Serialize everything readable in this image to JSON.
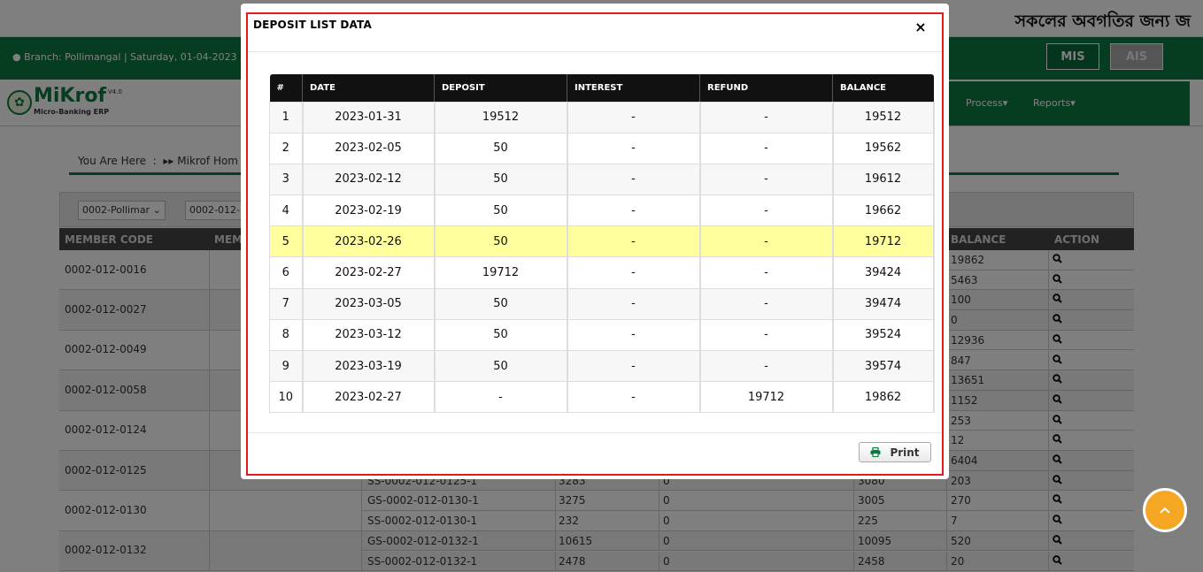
{
  "page": {
    "slogan": "সকলের অবগতির জন্য জ",
    "branch_info": "Branch: Pollimangal | Saturday, 01-04-2023",
    "mis_label": "MIS",
    "ais_label": "AIS",
    "logo": {
      "name": "MiKrof",
      "version": "V4.0",
      "subtitle": "Micro-Banking ERP"
    },
    "nav": {
      "process": "Process",
      "reports": "Reports"
    },
    "breadcrumb": {
      "prefix": "You Are Here",
      "item": "Mikrof Hom"
    },
    "filters": {
      "branch": "0002-Pollimar",
      "member": "0002-012-"
    },
    "table_headers": {
      "member_code": "MEMBER CODE",
      "member": "MEMB",
      "balance": "BALANCE",
      "action": "ACTION"
    },
    "members": [
      "0002-012-0016",
      "0002-012-0027",
      "0002-012-0049",
      "0002-012-0058",
      "0002-012-0124",
      "0002-012-0125",
      "0002-012-0130",
      "0002-012-0132"
    ],
    "balances": [
      "19862",
      "5463",
      "100",
      "0",
      "12936",
      "847",
      "13651",
      "1152",
      "253",
      "12",
      "6404",
      "203",
      "270",
      "7",
      "520",
      "20"
    ],
    "partial_rows": [
      {
        "account": "SS-0002-012-0125-1",
        "a": "3283",
        "b": "0",
        "c": "3080"
      },
      {
        "account": "GS-0002-012-0130-1",
        "a": "3275",
        "b": "0",
        "c": "3005"
      },
      {
        "account": "SS-0002-012-0130-1",
        "a": "232",
        "b": "0",
        "c": "225"
      },
      {
        "account": "GS-0002-012-0132-1",
        "a": "10615",
        "b": "0",
        "c": "10095"
      },
      {
        "account": "SS-0002-012-0132-1",
        "a": "2478",
        "b": "0",
        "c": "2458"
      }
    ]
  },
  "modal": {
    "title": "DEPOSIT LIST DATA",
    "close_glyph": "×",
    "print_label": "Print",
    "columns": [
      "#",
      "DATE",
      "DEPOSIT",
      "INTEREST",
      "REFUND",
      "BALANCE"
    ],
    "highlight_color": "#ffff9d",
    "rows": [
      {
        "n": "1",
        "date": "2023-01-31",
        "deposit": "19512",
        "interest": "-",
        "refund": "-",
        "balance": "19512"
      },
      {
        "n": "2",
        "date": "2023-02-05",
        "deposit": "50",
        "interest": "-",
        "refund": "-",
        "balance": "19562"
      },
      {
        "n": "3",
        "date": "2023-02-12",
        "deposit": "50",
        "interest": "-",
        "refund": "-",
        "balance": "19612"
      },
      {
        "n": "4",
        "date": "2023-02-19",
        "deposit": "50",
        "interest": "-",
        "refund": "-",
        "balance": "19662"
      },
      {
        "n": "5",
        "date": "2023-02-26",
        "deposit": "50",
        "interest": "-",
        "refund": "-",
        "balance": "19712",
        "highlight": true
      },
      {
        "n": "6",
        "date": "2023-02-27",
        "deposit": "19712",
        "interest": "-",
        "refund": "-",
        "balance": "39424"
      },
      {
        "n": "7",
        "date": "2023-03-05",
        "deposit": "50",
        "interest": "-",
        "refund": "-",
        "balance": "39474"
      },
      {
        "n": "8",
        "date": "2023-03-12",
        "deposit": "50",
        "interest": "-",
        "refund": "-",
        "balance": "39524"
      },
      {
        "n": "9",
        "date": "2023-03-19",
        "deposit": "50",
        "interest": "-",
        "refund": "-",
        "balance": "39574"
      },
      {
        "n": "10",
        "date": "2023-02-27",
        "deposit": "-",
        "interest": "-",
        "refund": "19712",
        "balance": "19862"
      }
    ]
  }
}
